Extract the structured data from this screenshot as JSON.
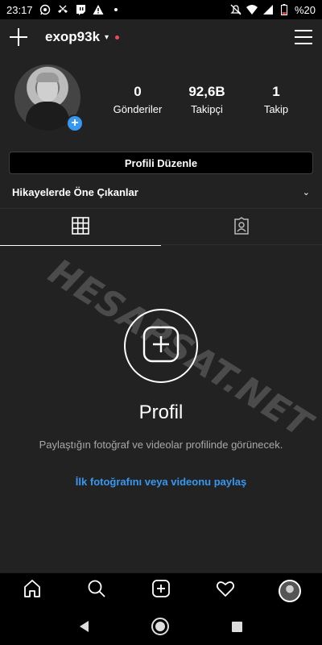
{
  "status_bar": {
    "time": "23:17",
    "battery": "%20",
    "left_icons": [
      "whatsapp-icon",
      "missed-call-icon",
      "twitch-icon",
      "warning-icon",
      "dot-icon"
    ],
    "right_icons": [
      "mute-icon",
      "wifi-icon",
      "signal-icon",
      "battery-icon"
    ]
  },
  "header": {
    "username": "exop93k",
    "new_post_icon": "plus-icon",
    "menu_icon": "hamburger-icon"
  },
  "profile": {
    "stats": [
      {
        "value": "0",
        "label": "Gönderiler"
      },
      {
        "value": "92,6B",
        "label": "Takipçi"
      },
      {
        "value": "1",
        "label": "Takip"
      }
    ],
    "edit_label": "Profili Düzenle",
    "highlights_label": "Hikayelerde Öne Çıkanlar"
  },
  "tabs": [
    {
      "name": "grid-icon",
      "active": true
    },
    {
      "name": "tagged-icon",
      "active": false
    }
  ],
  "empty_state": {
    "title": "Profil",
    "description": "Paylaştığın fotoğraf ve videolar profilinde görünecek.",
    "link": "İlk fotoğrafını veya videonu paylaş"
  },
  "watermark": "HESAPSAT.NET",
  "bottom_nav": [
    "home-icon",
    "search-icon",
    "new-post-icon",
    "heart-icon",
    "profile-avatar"
  ],
  "colors": {
    "background": "#222222",
    "accent": "#3897f0",
    "notification_dot": "#ed4956"
  }
}
